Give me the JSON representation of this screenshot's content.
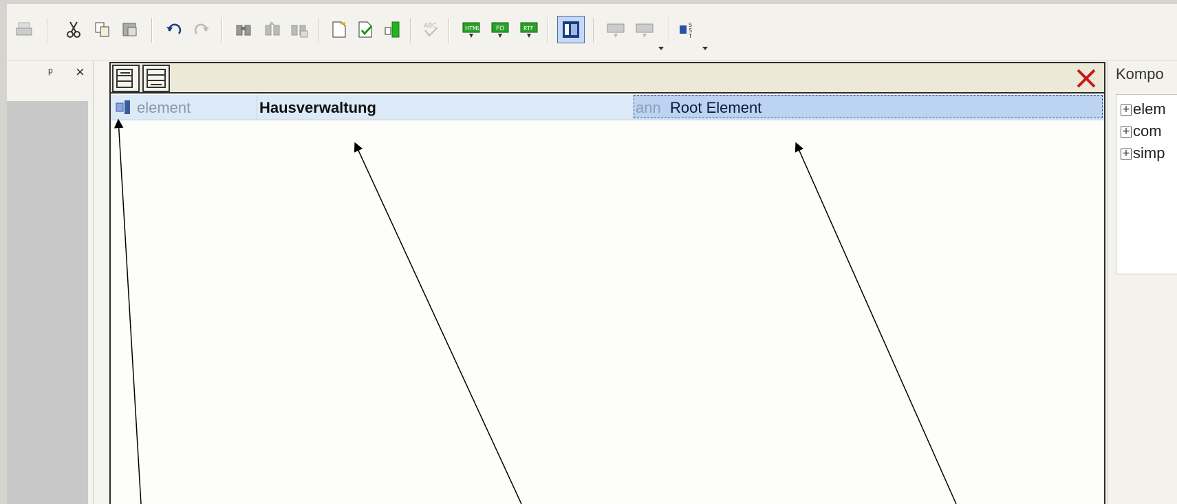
{
  "toolbar": {
    "icons": [
      "print-icon",
      "cut-icon",
      "copy-icon",
      "paste-icon",
      "undo-icon",
      "redo-icon",
      "find-icon",
      "find-next-icon",
      "replace-icon",
      "new-document-icon",
      "validate-icon",
      "insert-column-icon",
      "spellcheck-icon",
      "generate-html-icon",
      "generate-fo-icon",
      "generate-rtf-icon",
      "layout-view-icon",
      "print-preview-icon",
      "text-view-icon",
      "toolbar-options-icon"
    ]
  },
  "left_panel": {
    "pin_glyph": "ᵖ",
    "close_glyph": "×"
  },
  "designer": {
    "row": {
      "type_label": "element",
      "name": "Hausverwaltung",
      "ann_label": "ann",
      "ann_value": "Root Element"
    }
  },
  "right_panel": {
    "title": "Kompo",
    "tree": [
      {
        "label": "elem"
      },
      {
        "label": "com"
      },
      {
        "label": "simp"
      }
    ]
  }
}
